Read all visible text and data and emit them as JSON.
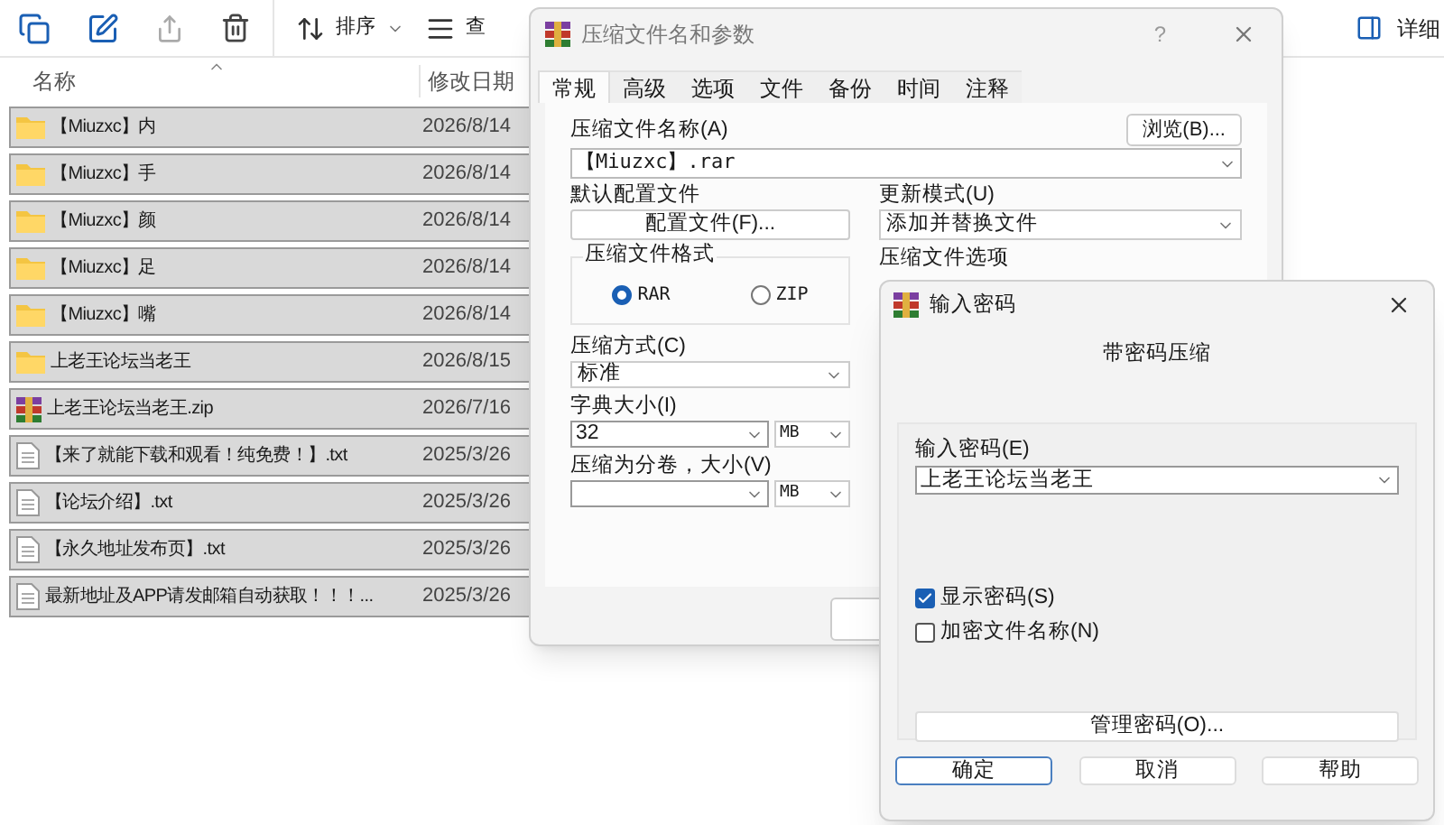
{
  "explorer": {
    "toolbar": [
      {
        "kind": "sort",
        "label": "排序"
      },
      {
        "kind": "view",
        "label": "查"
      }
    ],
    "details_label": "详细",
    "columns": [
      "名称",
      "修改日期"
    ],
    "rows": [
      {
        "kind": "folder",
        "name": "【Miuzxc】内",
        "date": "2026/8/14",
        "selected": true
      },
      {
        "kind": "folder",
        "name": "【Miuzxc】手",
        "date": "2026/8/14",
        "selected": true
      },
      {
        "kind": "folder",
        "name": "【Miuzxc】颜",
        "date": "2026/8/14",
        "selected": true
      },
      {
        "kind": "folder",
        "name": "【Miuzxc】足",
        "date": "2026/8/14",
        "selected": true
      },
      {
        "kind": "folder",
        "name": "【Miuzxc】嘴",
        "date": "2026/8/14",
        "selected": true
      },
      {
        "kind": "folder",
        "name": "上老王论坛当老王",
        "date": "2026/8/15",
        "selected": true
      },
      {
        "kind": "archive",
        "name": "上老王论坛当老王.zip",
        "date": "2026/7/16",
        "selected": true
      },
      {
        "kind": "text",
        "name": "【来了就能下载和观看！纯免费！】.txt",
        "date": "2025/3/26",
        "selected": true
      },
      {
        "kind": "text",
        "name": "【论坛介绍】.txt",
        "date": "2025/3/26",
        "selected": true
      },
      {
        "kind": "text",
        "name": "【永久地址发布页】.txt",
        "date": "2025/3/26",
        "selected": true
      },
      {
        "kind": "text",
        "name": "最新地址及APP请发邮箱自动获取！！！...",
        "date": "2025/3/26",
        "selected": true
      }
    ]
  },
  "archive_dialog": {
    "title": "压缩文件名和参数",
    "help": "?",
    "tabs": [
      {
        "label": "常规",
        "selected": true
      },
      {
        "label": "高级",
        "selected": false
      },
      {
        "label": "选项",
        "selected": false
      },
      {
        "label": "文件",
        "selected": false
      },
      {
        "label": "备份",
        "selected": false
      },
      {
        "label": "时间",
        "selected": false
      },
      {
        "label": "注释",
        "selected": false
      }
    ],
    "archive_name_label": "压缩文件名称(A)",
    "browse_button": "浏览(B)...",
    "archive_name": "【Miuzxc】.rar",
    "profile_label": "默认配置文件",
    "profile_button": "配置文件(F)...",
    "update_label": "更新模式(U)",
    "update_value": "添加并替换文件",
    "format_title": "压缩文件格式",
    "formats": [
      {
        "label": "RAR",
        "selected": true
      },
      {
        "label": "ZIP",
        "selected": false
      }
    ],
    "options_title": "压缩文件选项",
    "method_label": "压缩方式(C)",
    "method_value": "标准",
    "dict_label": "字典大小(I)",
    "dict_value": "32",
    "dict_unit": "MB",
    "volume_label": "压缩为分卷，大小(V)",
    "volume_unit": "MB"
  },
  "password_dialog": {
    "title": "输入密码",
    "heading": "带密码压缩",
    "password_label": "输入密码(E)",
    "password": "上老王论坛当老王",
    "checkboxes": [
      {
        "label": "显示密码(S)",
        "checked": true
      },
      {
        "label": "加密文件名称(N)",
        "checked": false
      }
    ],
    "manage_button": "管理密码(O)...",
    "buttons": [
      {
        "label": "确定",
        "default": true
      },
      {
        "label": "取消",
        "default": false
      },
      {
        "label": "帮助",
        "default": false
      }
    ]
  }
}
